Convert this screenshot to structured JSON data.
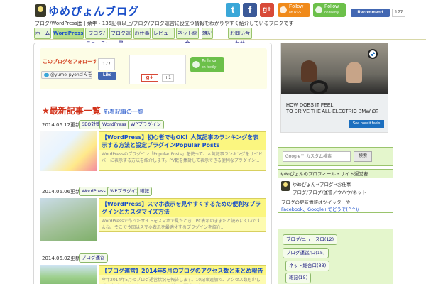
{
  "header": {
    "title": "ゆめぴょんブログ",
    "description": "ブログ/WordPress歴十余年・135記事以上/ブログ/ブログ運営に役立つ情報をわかりやすく紹介しているブログです"
  },
  "social": {
    "twitter": "t",
    "facebook": "f",
    "googleplus": "g+",
    "rss_follow": "Follow",
    "rss_sub": "on RSS",
    "feedly_follow": "Follow",
    "feedly_sub": "on feedly",
    "recommend": "Recommend",
    "recommend_count": "177"
  },
  "nav": [
    {
      "label": "ホーム"
    },
    {
      "label": "WordPress"
    },
    {
      "label": "ブログ/ニュース/ロ"
    },
    {
      "label": "ブログ運営"
    },
    {
      "label": "お仕事"
    },
    {
      "label": "レビュー"
    },
    {
      "label": "ネット総合"
    },
    {
      "label": "雑記"
    },
    {
      "label": "お問い合わせ"
    }
  ],
  "promo": {
    "title": "このブログをフォローする",
    "twitter_follow": "@yume_pyonさんをフォロー",
    "hatena_count": "177",
    "fb_like": "Like",
    "gp_dots": "...",
    "gp_plus": "g+",
    "gp_count": "+1",
    "feedly_follow": "Follow",
    "feedly_sub": "on feedly"
  },
  "section": {
    "title": "★最新記事一覧",
    "sub": "新着記事の一覧"
  },
  "posts": [
    {
      "date": "2014.06.12更新",
      "tags": [
        "SEO対策",
        "WordPress",
        "WPプラグイン"
      ],
      "title": "【WordPress】初心者でもOK！人気記事のランキングを表示する方法と設定プラグインPopular Posts",
      "excerpt": "WordPressのプラグイン「Popular Posts」を使って、人気記事ランキングをサイドバーに表示する方法を紹介します。PV数を集計して表示できる便利なプラグイン..."
    },
    {
      "date": "2014.06.06更新",
      "tags": [
        "WordPress",
        "WPプラグイン",
        "雑記"
      ],
      "title": "【WordPress】スマホ表示を見やすくするための便利なプラグインとカスタマイズ方法",
      "excerpt": "WordPressで作ったサイトをスマホで見たとき、PC表示のままだと読みにくいですよね。そこで今回はスマホ表示を最適化するプラグインを紹介..."
    },
    {
      "date": "2014.06.02更新",
      "tags": [
        "ブログ運営"
      ],
      "title": "【ブログ運営】2014年5月のブログのアクセス数とまとめ報告",
      "excerpt": "今年2014年5月のブログ運営状況を報告します。10記事追加で、アクセス数も少しずつ伸びてきました。Googleからの流入が増えてきた..."
    }
  ],
  "ad": {
    "line1": "HOW DOES IT FEEL",
    "line2": "TO DRIVE THE ALL-ELECTRIC BMW i3?",
    "cta": "See how it feels"
  },
  "search": {
    "placeholder": "Google™ カスタム検索",
    "button": "検索"
  },
  "profile": {
    "heading": "ゆめぴょんのプロフィール・サイト運営者",
    "line1": "ゆめぴょん→ブログ→お仕事",
    "line2": "ブログ/ブログ/運営ノウハウ/ネット",
    "line3": "ブログの更新情報はツイッターや",
    "line4": "Facebook、Google+でどうぞ(^^)/"
  },
  "categories": [
    {
      "label": "ブログ/ニュースロ(12)"
    },
    {
      "label": "ブログ運営/ロ(15)"
    },
    {
      "label": "ネット総合ロ(33)"
    },
    {
      "label": "雑記(15)"
    }
  ]
}
